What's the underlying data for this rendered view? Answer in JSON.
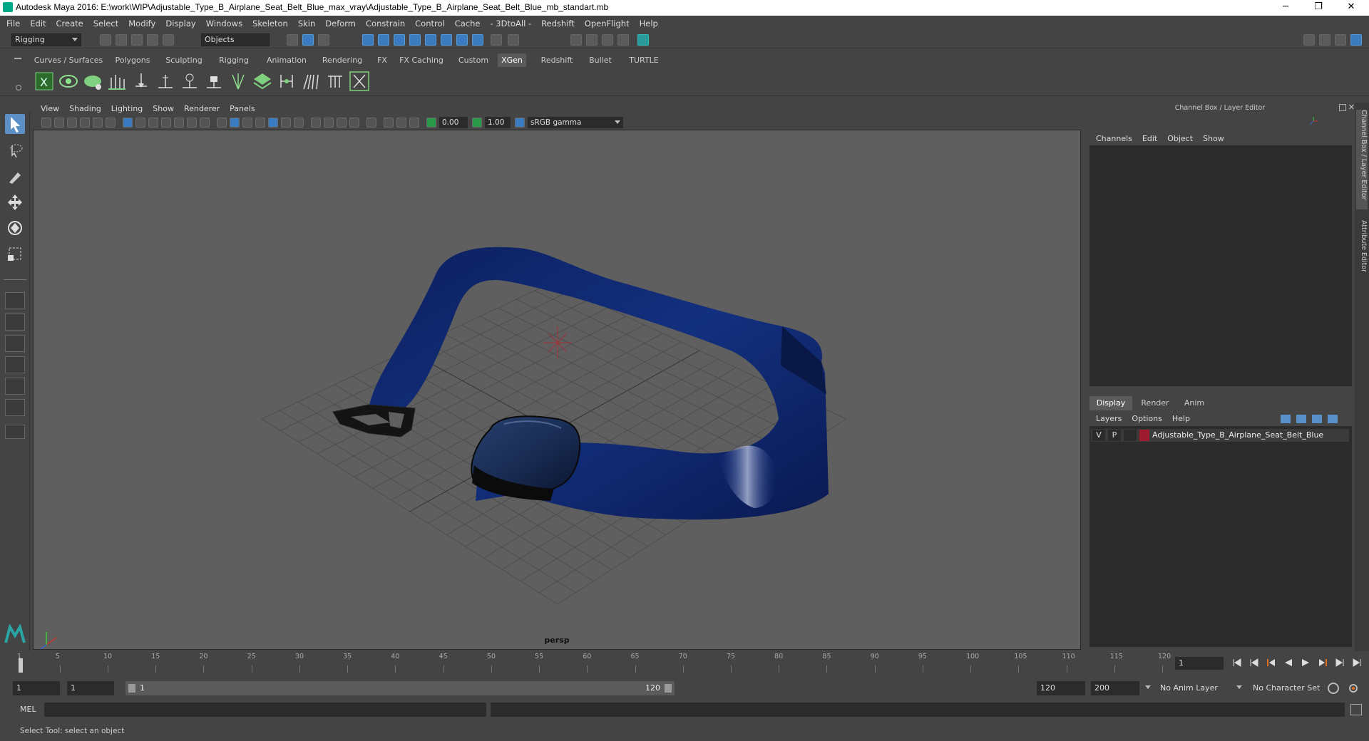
{
  "window": {
    "title": "Autodesk Maya 2016: E:\\work\\WIP\\Adjustable_Type_B_Airplane_Seat_Belt_Blue_max_vray\\Adjustable_Type_B_Airplane_Seat_Belt_Blue_mb_standart.mb",
    "minimize": "─",
    "maximize": "❐",
    "close": "✕"
  },
  "menubar": [
    "File",
    "Edit",
    "Create",
    "Select",
    "Modify",
    "Display",
    "Windows",
    "Skeleton",
    "Skin",
    "Deform",
    "Constrain",
    "Control",
    "Cache",
    "- 3DtoAll -",
    "Redshift",
    "OpenFlight",
    "Help"
  ],
  "statusline": {
    "mode": "Rigging",
    "selection_mode": "Objects"
  },
  "shelf": {
    "tabs": [
      "Curves / Surfaces",
      "Polygons",
      "Sculpting",
      "Rigging",
      "Animation",
      "Rendering",
      "FX",
      "FX Caching",
      "Custom",
      "XGen",
      "Redshift",
      "Bullet",
      "TURTLE"
    ],
    "active_tab": "XGen"
  },
  "viewport": {
    "menus": [
      "View",
      "Shading",
      "Lighting",
      "Show",
      "Renderer",
      "Panels"
    ],
    "exposure": "0.00",
    "gamma": "1.00",
    "color_space": "sRGB gamma",
    "camera": "persp"
  },
  "channel_box": {
    "title": "Channel Box / Layer Editor",
    "menus": [
      "Channels",
      "Edit",
      "Object",
      "Show"
    ],
    "side_tabs": [
      "Channel Box / Layer Editor",
      "Attribute Editor"
    ]
  },
  "layer_editor": {
    "tabs": [
      "Display",
      "Render",
      "Anim"
    ],
    "active_tab": "Display",
    "menus": [
      "Layers",
      "Options",
      "Help"
    ],
    "layers": [
      {
        "visible": "V",
        "playback": "P",
        "color": "#9e1b2f",
        "name": "Adjustable_Type_B_Airplane_Seat_Belt_Blue"
      }
    ]
  },
  "timeline": {
    "ticks": [
      "1",
      "5",
      "10",
      "15",
      "20",
      "25",
      "30",
      "35",
      "40",
      "45",
      "50",
      "55",
      "60",
      "65",
      "70",
      "75",
      "80",
      "85",
      "90",
      "95",
      "100",
      "105",
      "110",
      "115",
      "120"
    ],
    "current_frame": "1"
  },
  "range": {
    "start": "1",
    "playback_start": "1",
    "slider_start": "1",
    "slider_end": "120",
    "playback_end": "120",
    "end": "200",
    "anim_layer": "No Anim Layer",
    "character_set": "No Character Set"
  },
  "command_line": {
    "label": "MEL"
  },
  "help_line": {
    "text": "Select Tool: select an object"
  }
}
